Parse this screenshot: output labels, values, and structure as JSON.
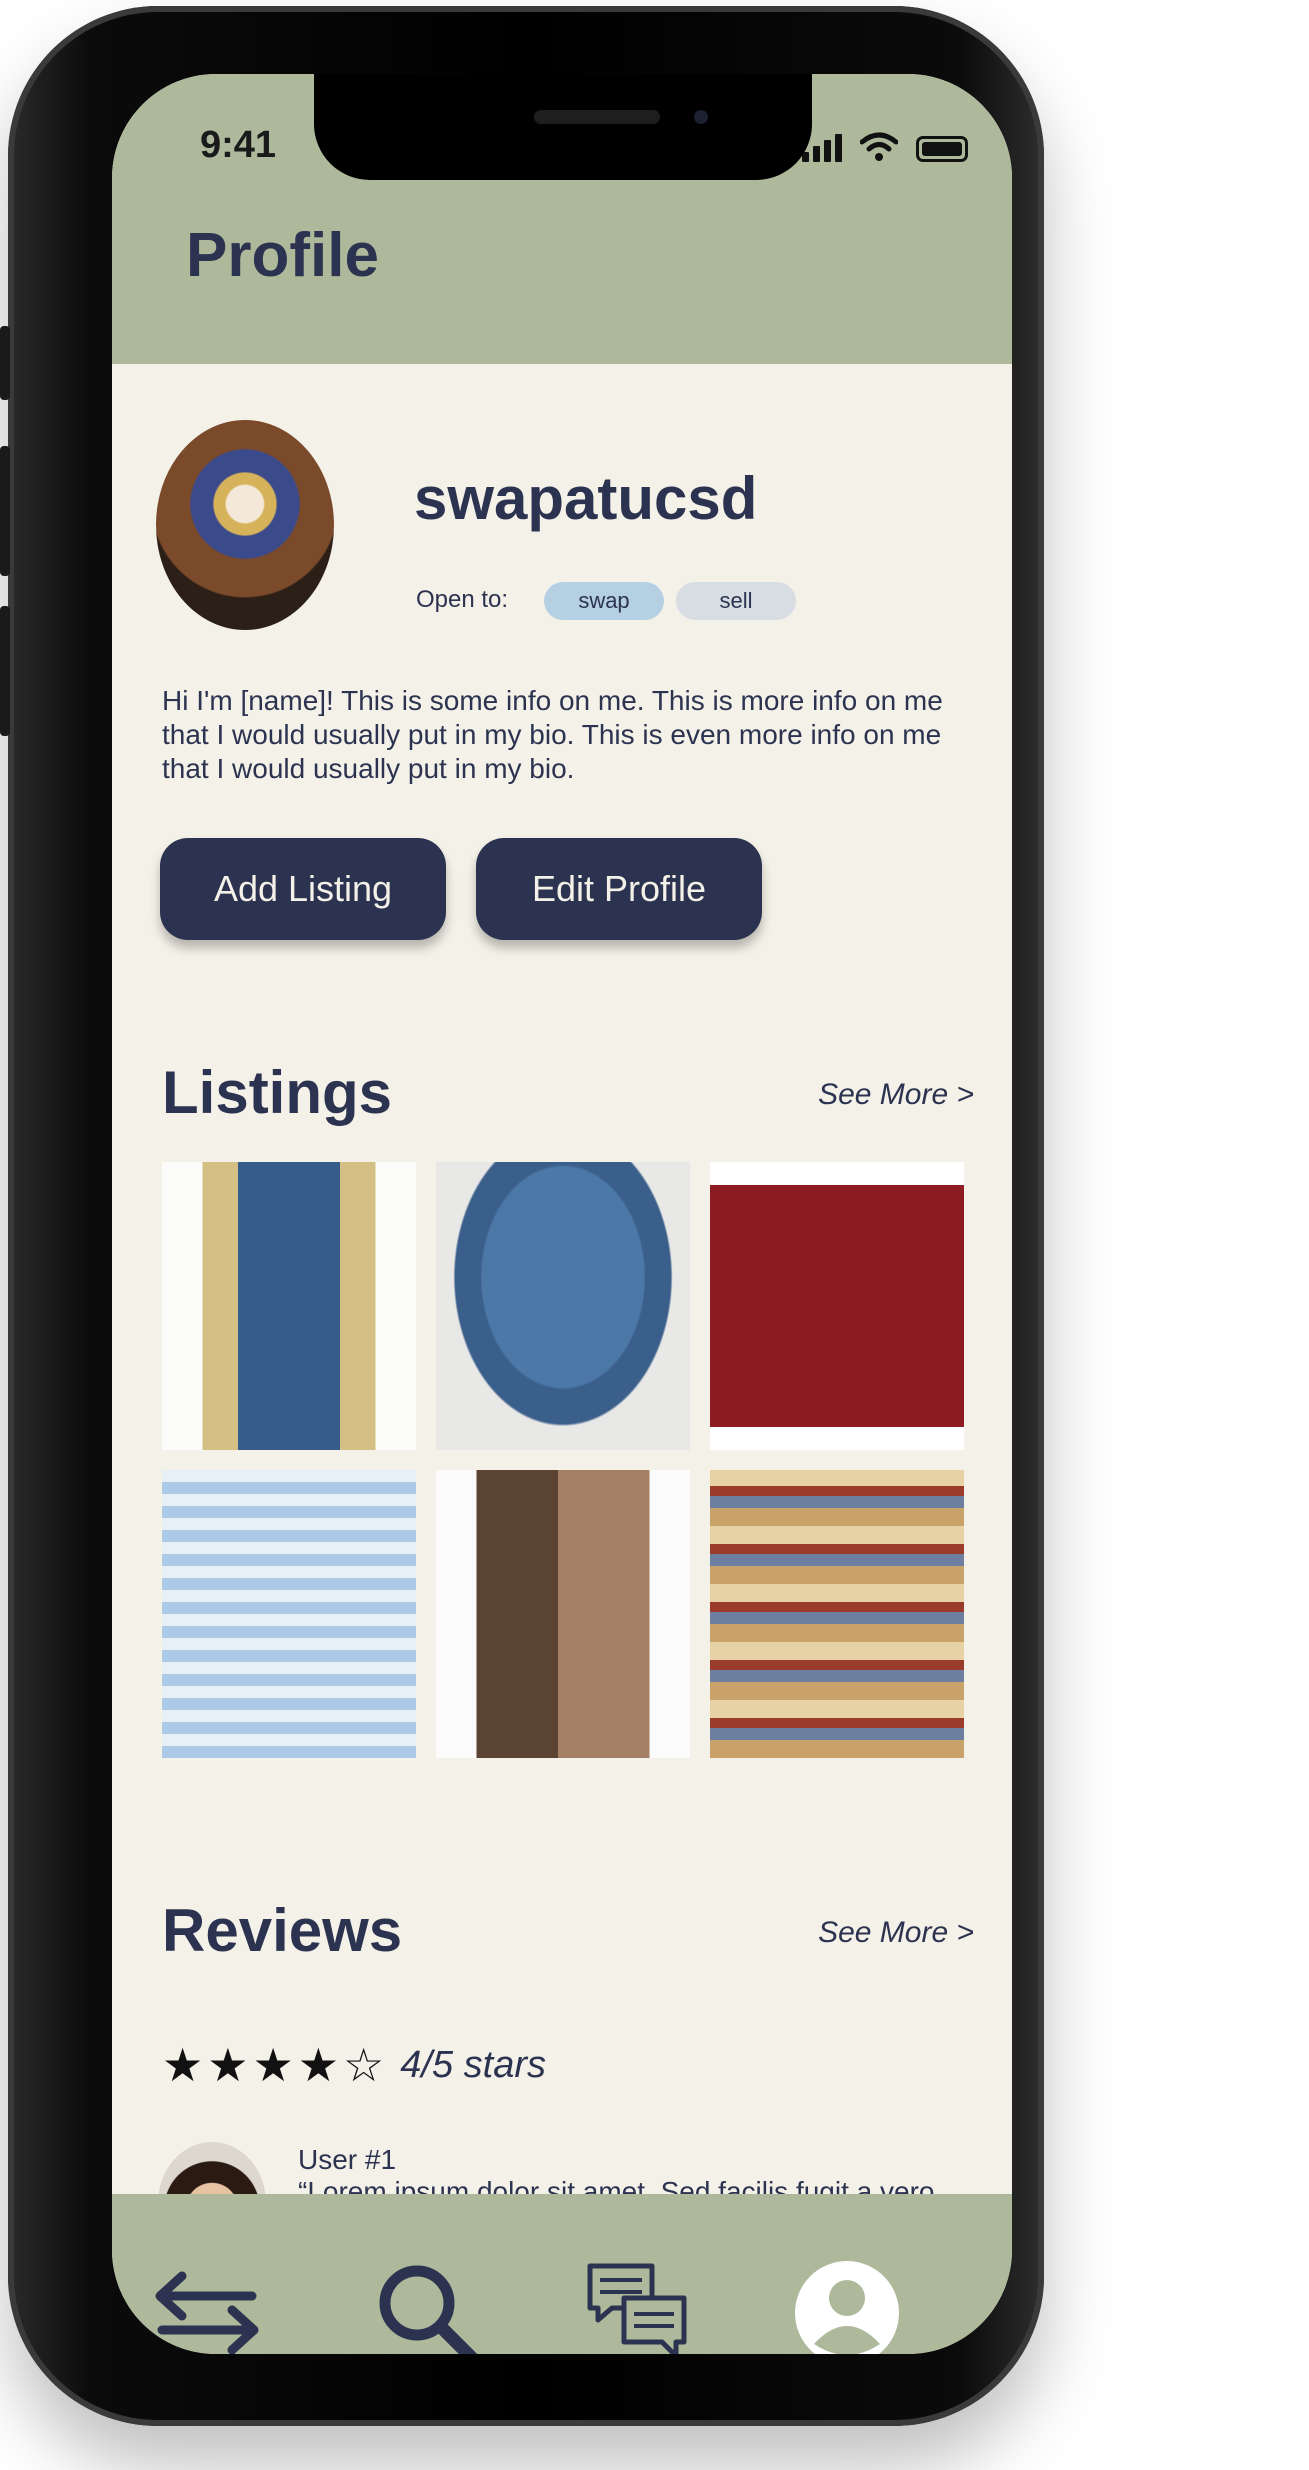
{
  "status_bar": {
    "time": "9:41"
  },
  "header": {
    "title": "Profile"
  },
  "profile": {
    "username": "swapatucsd",
    "open_to_label": "Open to:",
    "tags": [
      "swap",
      "sell"
    ],
    "bio": "Hi I'm [name]! This is some info on me. This is more info on me that I would usually put in my bio. This is even more info on me that I would usually put in my bio."
  },
  "actions": {
    "add_listing": "Add Listing",
    "edit_profile": "Edit Profile"
  },
  "listings": {
    "title": "Listings",
    "see_more": "See More >",
    "items": [
      "denim varsity jacket",
      "denim shorts",
      "red t-shirt",
      "blue plaid pajama set",
      "brown knit tank top",
      "fair isle sweater"
    ]
  },
  "reviews": {
    "title": "Reviews",
    "see_more": "See More >",
    "rating": 4,
    "rating_max": 5,
    "rating_text": "4/5 stars",
    "items": [
      {
        "user": "User #1",
        "text": "“Lorem ipsum dolor sit amet. Sed facilis fugit a vero laborum dicta sunt.”"
      }
    ]
  },
  "tabs": [
    "swap-icon",
    "search-icon",
    "chat-icon",
    "profile-icon"
  ],
  "colors": {
    "header": "#adb99a",
    "background": "#f4f1e8",
    "primary": "#2c3350",
    "tag_swap": "#b5cfe3",
    "tag_sell": "#d6dde3"
  }
}
